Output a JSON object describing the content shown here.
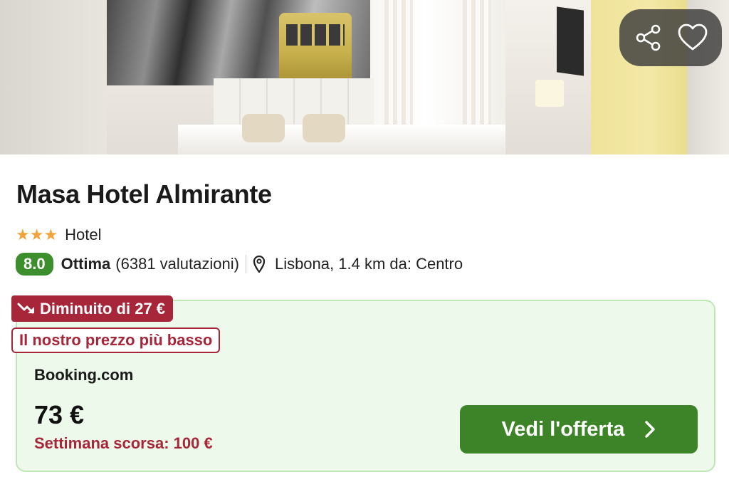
{
  "hotel": {
    "name": "Masa Hotel Almirante",
    "star_rating": 3,
    "stars_glyphs": "★★★",
    "type": "Hotel",
    "rating_score": "8.0",
    "rating_label": "Ottima",
    "reviews": "(6381 valutazioni)",
    "location": "Lisbona, 1.4 km da: Centro"
  },
  "actions": {
    "share_icon": "share-icon",
    "favorite_icon": "heart-icon"
  },
  "offer": {
    "drop_badge": "Diminuito di 27 €",
    "drop_icon": "trend-down-icon",
    "lowest_badge": "Il nostro prezzo più basso",
    "provider": "Booking.com",
    "price": "73 €",
    "last_week": "Settimana scorsa: 100 €",
    "cta_label": "Vedi l'offerta"
  },
  "colors": {
    "score_green": "#3d8f2d",
    "cta_green": "#3d8429",
    "offer_bg": "#edf9ea",
    "deal_red": "#a7263a",
    "star_orange": "#f2a43a"
  }
}
